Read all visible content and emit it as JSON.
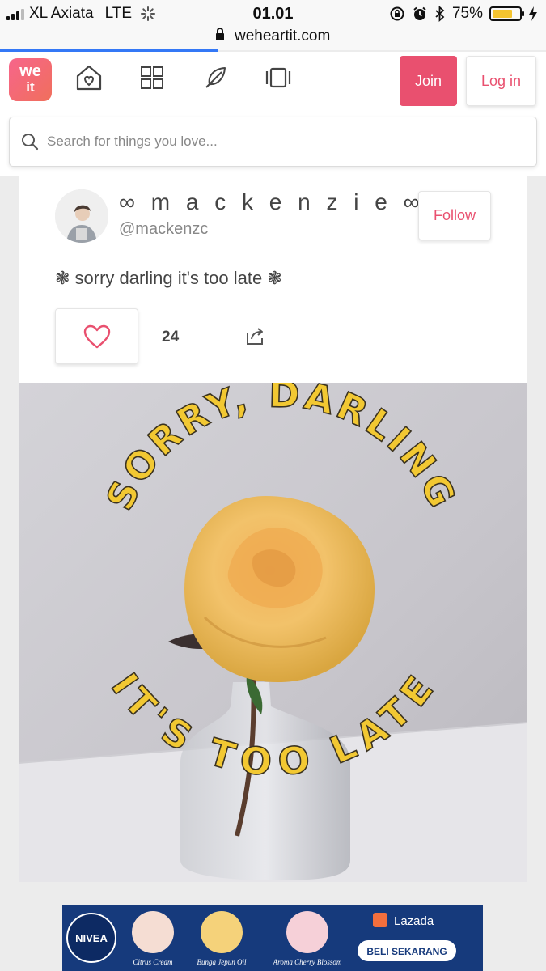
{
  "status_bar": {
    "carrier": "XL Axiata",
    "network": "LTE",
    "time": "01.01",
    "battery_percent": "75%",
    "battery_level": 0.75
  },
  "browser": {
    "url": "weheartit.com",
    "load_progress": 0.4
  },
  "header": {
    "logo_text_top": "we",
    "logo_text_bottom": "it",
    "nav_icons": [
      "home-heart-icon",
      "grid-icon",
      "feather-icon",
      "collections-icon"
    ],
    "join_label": "Join",
    "login_label": "Log in"
  },
  "search": {
    "placeholder": "Search for things you love..."
  },
  "post": {
    "display_name": "∞ m a c k e n z i e ∞",
    "username": "@mackenzc",
    "follow_label": "Follow",
    "caption": "❃ sorry darling it's too late ❃",
    "like_count": "24",
    "image_text": {
      "arc_top": "SORRY, DARLING",
      "arc_bottom": "IT'S TOO LATE"
    }
  },
  "ad": {
    "brand": "NIVEA",
    "products": [
      "Citrus Cream",
      "Bunga Jepun Oil",
      "Aroma Cherry Blossom"
    ],
    "store": "Lazada",
    "cta": "BELI SEKARANG"
  },
  "colors": {
    "accent": "#e9506f",
    "progress": "#3478f6",
    "text_yellow": "#f2c832",
    "ad_bg": "#163a7c"
  }
}
